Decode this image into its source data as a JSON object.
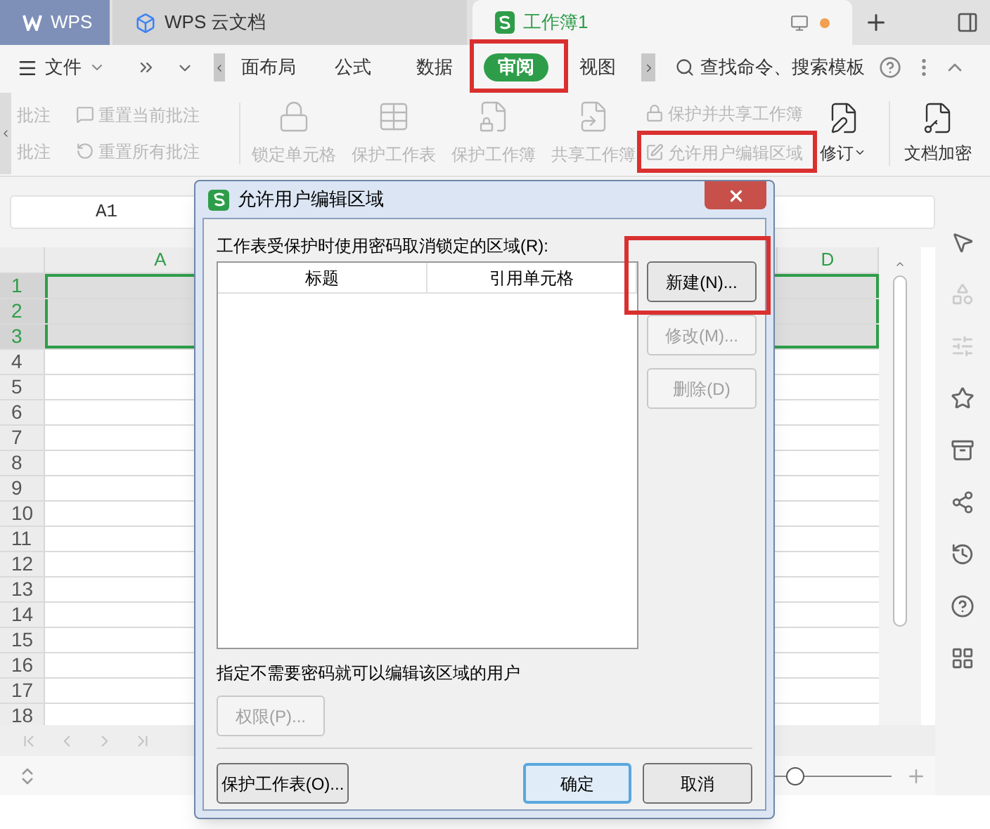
{
  "tabs": [
    {
      "label": "WPS",
      "kind": "home",
      "selected": false
    },
    {
      "label": "WPS 云文档",
      "kind": "cloud",
      "selected": false
    },
    {
      "label": "工作簿1",
      "kind": "sheet",
      "selected": true
    }
  ],
  "menu": {
    "file": "文件",
    "tabs": [
      {
        "label": "面布局",
        "selected": false,
        "highlighted": false
      },
      {
        "label": "公式",
        "selected": false,
        "highlighted": false
      },
      {
        "label": "数据",
        "selected": false,
        "highlighted": false
      },
      {
        "label": "审阅",
        "selected": true,
        "highlighted": true
      },
      {
        "label": "视图",
        "selected": false,
        "highlighted": false
      }
    ],
    "search": "查找命令、搜索模板"
  },
  "ribbon": {
    "small": [
      {
        "label": "批注",
        "disabled": true
      },
      {
        "label": "批注",
        "disabled": true
      },
      {
        "label": "重置当前批注",
        "disabled": true
      },
      {
        "label": "重置所有批注",
        "disabled": true
      }
    ],
    "large": [
      {
        "label": "锁定单元格",
        "kind": "lock",
        "disabled": true
      },
      {
        "label": "保护工作表",
        "kind": "sheet",
        "disabled": true
      },
      {
        "label": "保护工作簿",
        "kind": "book",
        "disabled": true
      },
      {
        "label": "共享工作簿",
        "kind": "share",
        "disabled": true
      }
    ],
    "stack": [
      {
        "label": "保护并共享工作簿",
        "disabled": true,
        "highlighted": false
      },
      {
        "label": "允许用户编辑区域",
        "disabled": true,
        "highlighted": true
      }
    ],
    "revise": {
      "label": "修订",
      "disabled": false
    },
    "encrypt": {
      "label": "文档加密",
      "disabled": false
    }
  },
  "name_box": "A1",
  "columns": [
    {
      "label": "A"
    },
    {
      "label": "D"
    }
  ],
  "rows": [
    {
      "label": "1",
      "selected": true
    },
    {
      "label": "2",
      "selected": true
    },
    {
      "label": "3",
      "selected": true
    },
    {
      "label": "4",
      "selected": false
    },
    {
      "label": "5",
      "selected": false
    },
    {
      "label": "6",
      "selected": false
    },
    {
      "label": "7",
      "selected": false
    },
    {
      "label": "8",
      "selected": false
    },
    {
      "label": "9",
      "selected": false
    },
    {
      "label": "10",
      "selected": false
    },
    {
      "label": "11",
      "selected": false
    },
    {
      "label": "12",
      "selected": false
    },
    {
      "label": "13",
      "selected": false
    },
    {
      "label": "14",
      "selected": false
    },
    {
      "label": "15",
      "selected": false
    },
    {
      "label": "16",
      "selected": false
    },
    {
      "label": "17",
      "selected": false
    },
    {
      "label": "18",
      "selected": false
    }
  ],
  "zoom": {
    "level": 0.45
  },
  "dialog": {
    "title": "允许用户编辑区域",
    "list_label": "工作表受保护时使用密码取消锁定的区域(R):",
    "columns": [
      "标题",
      "引用单元格"
    ],
    "side_buttons": [
      {
        "label": "新建(N)...",
        "disabled": false,
        "highlighted": true
      },
      {
        "label": "修改(M)...",
        "disabled": true,
        "highlighted": false
      },
      {
        "label": "删除(D)",
        "disabled": true,
        "highlighted": false
      }
    ],
    "users_label": "指定不需要密码就可以编辑该区域的用户",
    "permissions": {
      "label": "权限(P)...",
      "disabled": true
    },
    "protect": {
      "label": "保护工作表(O)..."
    },
    "ok": {
      "label": "确定",
      "default": true
    },
    "cancel": {
      "label": "取消"
    }
  }
}
